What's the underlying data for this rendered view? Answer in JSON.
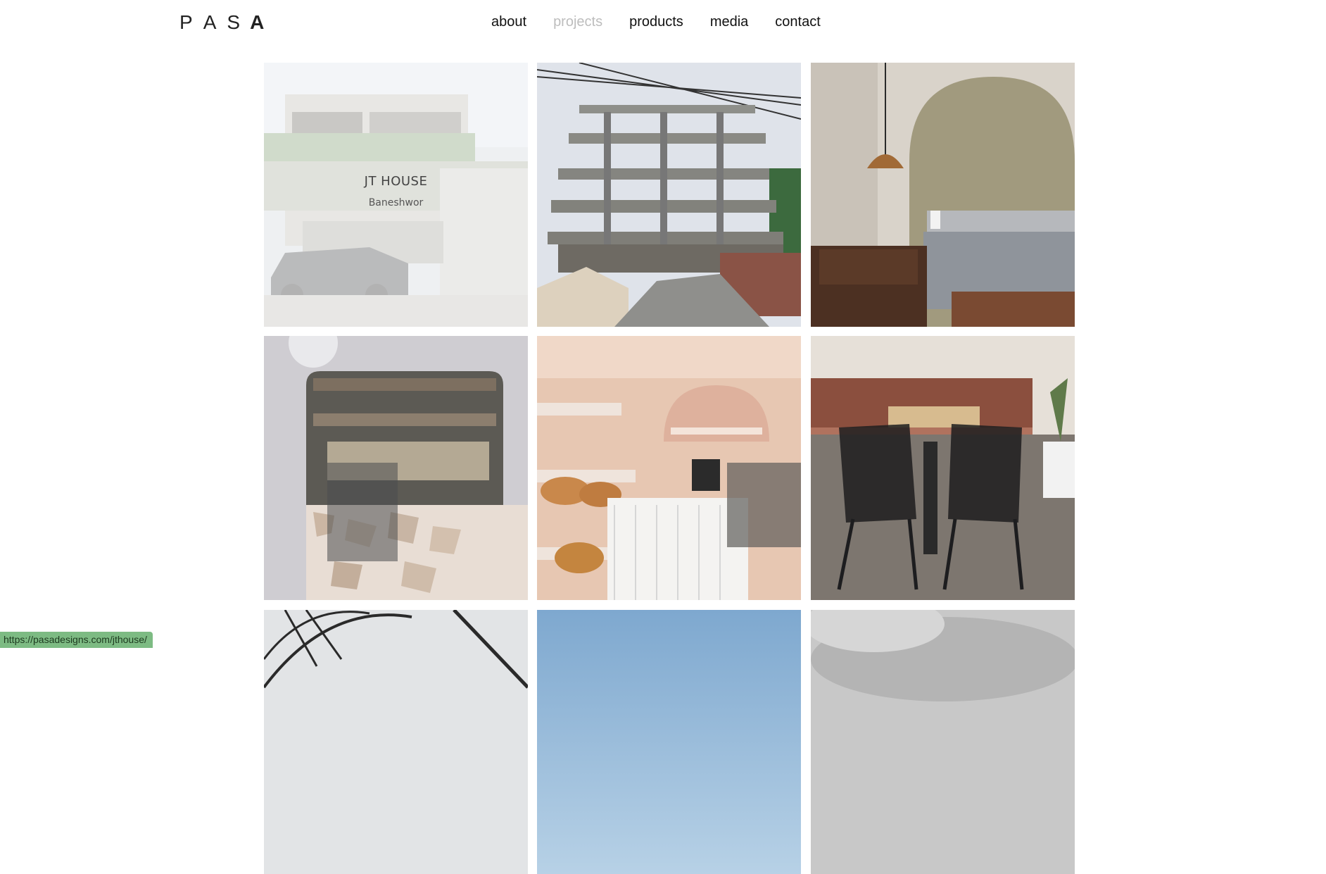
{
  "brand": {
    "logo_letters": [
      "P",
      "A",
      "S",
      "A"
    ]
  },
  "nav": {
    "items": [
      {
        "label": "about",
        "active": false
      },
      {
        "label": "projects",
        "active": true
      },
      {
        "label": "products",
        "active": false
      },
      {
        "label": "media",
        "active": false
      },
      {
        "label": "contact",
        "active": false
      }
    ]
  },
  "projects": {
    "hovered": {
      "title": "JT HOUSE",
      "location": "Baneshwor"
    },
    "tiles": [
      {
        "image": "house-exterior-photo"
      },
      {
        "image": "building-construction-photo"
      },
      {
        "image": "bedroom-interior-photo"
      },
      {
        "image": "cafe-window-counter-photo"
      },
      {
        "image": "bakery-interior-photo"
      },
      {
        "image": "cafe-dining-table-photo"
      },
      {
        "image": "steel-frame-photo"
      },
      {
        "image": "sky-photo"
      },
      {
        "image": "cloudy-sky-photo"
      }
    ]
  },
  "status_bar": {
    "url": "https://pasadesigns.com/jthouse/"
  },
  "colors": {
    "nav_active": "#bdbdbd",
    "nav_default": "#111111",
    "status_bg": "#7dbb83"
  }
}
